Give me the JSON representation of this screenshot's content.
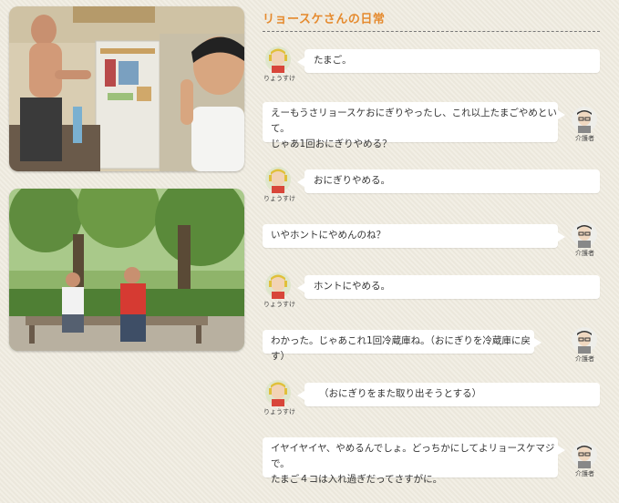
{
  "section": {
    "title": "リョースケさんの日常"
  },
  "speakers": {
    "ryosuke": "りょうすけ",
    "caregiver": "介護者"
  },
  "dialogue": [
    {
      "speaker": "ryosuke",
      "text": "たまご。"
    },
    {
      "speaker": "caregiver",
      "line1": "えーもうさリョースケおにぎりやったし、これ以上たまごやめといて。",
      "line2": "じゃあ1回おにぎりやめる？"
    },
    {
      "speaker": "ryosuke",
      "text": "おにぎりやめる。"
    },
    {
      "speaker": "caregiver",
      "text": "いやホントにやめんのね？"
    },
    {
      "speaker": "ryosuke",
      "text": "ホントにやめる。"
    },
    {
      "speaker": "caregiver",
      "text": "わかった。じゃあこれ1回冷蔵庫ね。（おにぎりを冷蔵庫に戻す）"
    },
    {
      "speaker": "ryosuke",
      "text": "（おにぎりをまた取り出そうとする）"
    },
    {
      "speaker": "caregiver",
      "line1": "イヤイヤイヤ、やめるんでしょ。どっちかにしてよリョースケマジで。",
      "line2": "たまご４コは入れ過ぎだってさすがに。"
    }
  ],
  "colors": {
    "title": "#e58a2e",
    "background": "#efebdf",
    "bubble": "#ffffff"
  }
}
